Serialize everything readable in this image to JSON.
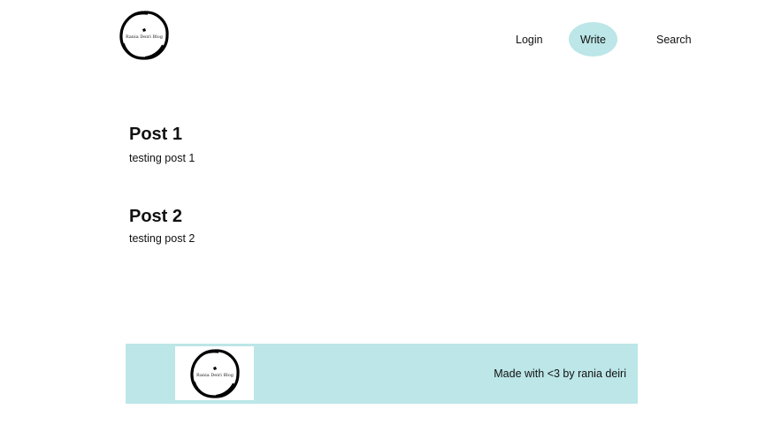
{
  "header": {
    "logo_text": "Rania Deiri Blog",
    "nav": {
      "login_label": "Login",
      "write_label": "Write",
      "search_label": "Search"
    }
  },
  "posts": [
    {
      "title": "Post 1",
      "body": "testing post 1"
    },
    {
      "title": "Post 2",
      "body": "testing post 2"
    }
  ],
  "footer": {
    "logo_text": "Rania Deiri Blog",
    "credit": "Made with <3 by rania deiri"
  },
  "colors": {
    "accent": "#bce6e7",
    "text": "#111111",
    "background": "#ffffff"
  }
}
